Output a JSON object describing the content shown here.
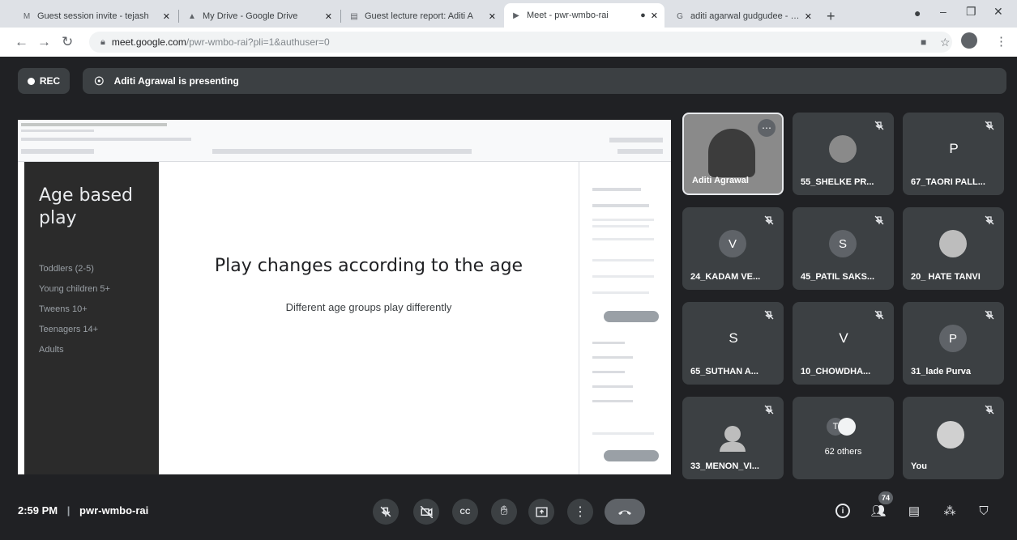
{
  "browser": {
    "tabs": [
      {
        "icon": "gmail-icon",
        "title": "Guest session invite - tejash"
      },
      {
        "icon": "google-drive-icon",
        "title": "My Drive - Google Drive"
      },
      {
        "icon": "google-docs-icon",
        "title": "Guest lecture report: Aditi A"
      },
      {
        "icon": "google-meet-icon",
        "title": "Meet - pwr-wmbo-rai"
      },
      {
        "icon": "google-icon",
        "title": "aditi agarwal gudgudee - Go"
      }
    ],
    "new_tab_label": "+",
    "url_host": "meet.google.com",
    "url_path": "/pwr-wmbo-rai?pli=1&authuser=0"
  },
  "meet": {
    "rec_label": "REC",
    "presenting_label": "Aditi Agrawal is presenting",
    "slide": {
      "sidebar_title_line1": "Age based",
      "sidebar_title_line2": "play",
      "sidebar_items": [
        "Toddlers (2-5)",
        "Young children 5+",
        "Tweens 10+",
        "Teenagers 14+",
        "Adults"
      ],
      "heading": "Play changes according to the age",
      "subheading": "Different age groups play differently"
    },
    "participants": [
      {
        "name": "Aditi Agrawal",
        "avatar": "",
        "type": "video"
      },
      {
        "name": "55_SHELKE PR...",
        "avatar": "",
        "type": "photo"
      },
      {
        "name": "67_TAORI PALL...",
        "avatar": "P",
        "type": "letter-plain"
      },
      {
        "name": "24_KADAM VE...",
        "avatar": "V",
        "type": "letter"
      },
      {
        "name": "45_PATIL SAKS...",
        "avatar": "S",
        "type": "letter"
      },
      {
        "name": "20_ HATE TANVI",
        "avatar": "",
        "type": "photo"
      },
      {
        "name": "65_SUTHAN A...",
        "avatar": "S",
        "type": "letter-plain"
      },
      {
        "name": "10_CHOWDHA...",
        "avatar": "V",
        "type": "letter-plain"
      },
      {
        "name": "31_lade Purva",
        "avatar": "P",
        "type": "letter"
      },
      {
        "name": "33_MENON_VI...",
        "avatar": "",
        "type": "person"
      },
      {
        "name": "62 others",
        "avatar": "T",
        "type": "others"
      },
      {
        "name": "You",
        "avatar": "",
        "type": "photo"
      }
    ],
    "bottom": {
      "time": "2:59 PM",
      "meeting_code": "pwr-wmbo-rai",
      "people_count": "74"
    }
  }
}
